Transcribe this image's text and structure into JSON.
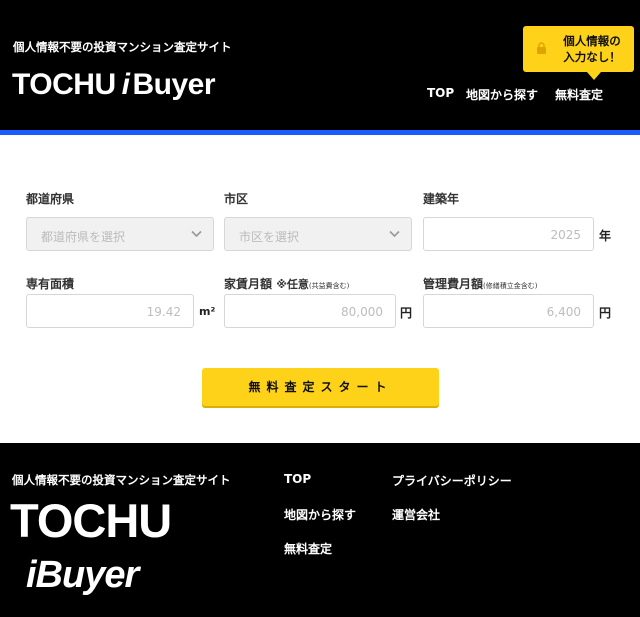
{
  "header": {
    "tagline": "個人情報不要の投資マンション査定サイト",
    "logo_left": "TOCHU",
    "logo_i": "i",
    "logo_right": "Buyer",
    "promo_line1": "個人情報の",
    "promo_line2": "入力なし！",
    "nav": [
      "TOP",
      "地図から探す",
      "無料査定"
    ]
  },
  "form": {
    "prefecture_label": "都道府県",
    "prefecture_placeholder": "都道府県を選択",
    "city_label": "市区",
    "city_placeholder": "市区を選択",
    "built_year_label": "建築年",
    "built_year_value": "2025",
    "built_year_unit": "年",
    "area_label": "専有面積",
    "area_value": "19.42",
    "area_unit": "m²",
    "rent_label": "家賃月額",
    "rent_optional": "※任意",
    "rent_note": "(共益費含む)",
    "rent_value": "80,000",
    "rent_unit": "円",
    "fee_label": "管理費月額",
    "fee_note": "(修繕積立金含む)",
    "fee_value": "6,400",
    "fee_unit": "円",
    "start_button": "無料査定スタート"
  },
  "footer": {
    "tagline": "個人情報不要の投資マンション査定サイト",
    "logo_line1": "TOCHU",
    "logo_line2": "iBuyer",
    "links_col1": [
      "TOP",
      "地図から探す",
      "無料査定"
    ],
    "links_col2": [
      "プライバシーポリシー",
      "運営会社"
    ]
  },
  "colors": {
    "accent_yellow": "#ffd21a",
    "accent_blue": "#1a5cff",
    "background": "#000000"
  }
}
